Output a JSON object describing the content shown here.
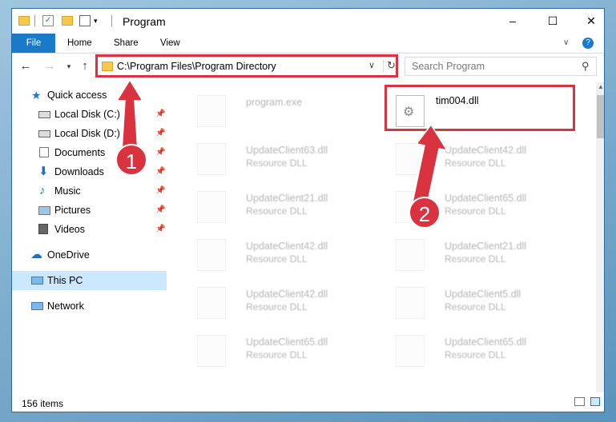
{
  "window": {
    "title": "Program",
    "controls": {
      "minimize": "–",
      "maximize": "☐",
      "close": "✕"
    }
  },
  "ribbon": {
    "tabs": [
      "File",
      "Home",
      "Share",
      "View"
    ]
  },
  "navigation": {
    "address": "C:\\Program Files\\Program Directory",
    "search_placeholder": "Search Program"
  },
  "sidebar": {
    "quick_access": "Quick access",
    "items": [
      {
        "label": "Local Disk (C:)",
        "icon": "drive-icon"
      },
      {
        "label": "Local Disk (D:)",
        "icon": "drive-icon"
      },
      {
        "label": "Documents",
        "icon": "documents-icon"
      },
      {
        "label": "Downloads",
        "icon": "downloads-icon"
      },
      {
        "label": "Music",
        "icon": "music-icon"
      },
      {
        "label": "Pictures",
        "icon": "pictures-icon"
      },
      {
        "label": "Videos",
        "icon": "videos-icon"
      }
    ],
    "onedrive": "OneDrive",
    "this_pc": "This PC",
    "network": "Network"
  },
  "files": [
    {
      "name": "program.exe",
      "type": "",
      "faded": true
    },
    {
      "name": "tim004.dll",
      "type": "",
      "faded": false
    },
    {
      "name": "UpdateClient63.dll",
      "type": "Resource DLL",
      "faded": true
    },
    {
      "name": "UpdateClient42.dll",
      "type": "Resource DLL",
      "faded": true
    },
    {
      "name": "UpdateClient21.dll",
      "type": "Resource DLL",
      "faded": true
    },
    {
      "name": "UpdateClient65.dll",
      "type": "Resource DLL",
      "faded": true
    },
    {
      "name": "UpdateClient42.dll",
      "type": "Resource DLL",
      "faded": true
    },
    {
      "name": "UpdateClient21.dll",
      "type": "Resource DLL",
      "faded": true
    },
    {
      "name": "UpdateClient42.dll",
      "type": "Resource DLL",
      "faded": true
    },
    {
      "name": "UpdateClient5.dll",
      "type": "Resource DLL",
      "faded": true
    },
    {
      "name": "UpdateClient65.dll",
      "type": "Resource DLL",
      "faded": true
    },
    {
      "name": "UpdateClient65.dll",
      "type": "Resource DLL",
      "faded": true
    }
  ],
  "status": {
    "item_count": "156 items"
  },
  "annotations": {
    "step1": "1",
    "step2": "2",
    "color": "#d9333f"
  }
}
